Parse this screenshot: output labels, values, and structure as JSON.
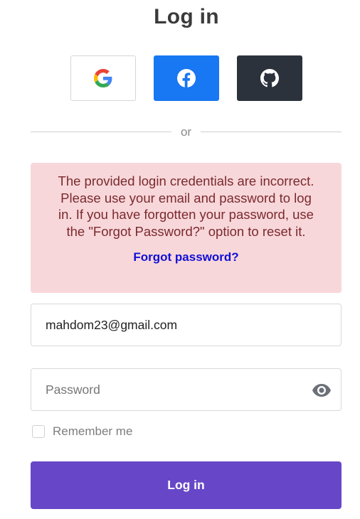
{
  "header": {
    "title": "Log in"
  },
  "social": {
    "buttons": [
      {
        "provider": "google",
        "icon": "google-icon",
        "color": "#ffffff"
      },
      {
        "provider": "facebook",
        "icon": "facebook-icon",
        "color": "#1877f2"
      },
      {
        "provider": "github",
        "icon": "github-icon",
        "color": "#2b323b"
      }
    ]
  },
  "divider": {
    "label": "or"
  },
  "alert": {
    "message": "The provided login credentials are incorrect. Please use your email and password to log in. If you have forgotten your password, use the \"Forgot Password?\" option to reset it.",
    "link_label": "Forgot password?",
    "background": "#f8d7da",
    "text_color": "#7a2a2e",
    "link_color": "#1010d8"
  },
  "form": {
    "email": {
      "value": "mahdom23@gmail.com",
      "placeholder": ""
    },
    "password": {
      "value": "",
      "placeholder": "Password",
      "toggle_icon": "eye-icon"
    },
    "remember": {
      "label": "Remember me",
      "checked": false
    },
    "submit_label": "Log in",
    "accent": "#6747c7"
  }
}
